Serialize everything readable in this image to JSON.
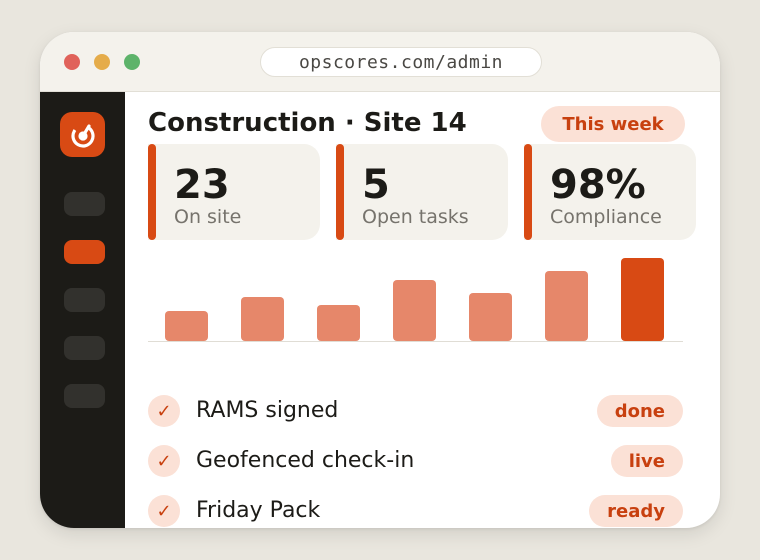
{
  "browser": {
    "url": "opscores.com/admin"
  },
  "sidebar": {
    "logo_icon": "crane-hook-icon",
    "accent": "#d84a14",
    "active_index": 1,
    "item_count": 5
  },
  "header": {
    "title": "Construction · Site 14",
    "period_pill": "This week"
  },
  "stats": [
    {
      "value": "23",
      "label": "On site"
    },
    {
      "value": "5",
      "label": "Open tasks"
    },
    {
      "value": "98%",
      "label": "Compliance"
    }
  ],
  "chart_data": {
    "type": "bar",
    "categories": [
      "",
      "",
      "",
      "",
      "",
      "",
      ""
    ],
    "values": [
      28,
      40,
      33,
      56,
      44,
      64,
      76
    ],
    "highlight_index": 6,
    "ylim": [
      0,
      80
    ],
    "colors": {
      "normal": "#e6876a",
      "highlight": "#d84a14"
    }
  },
  "checklist": [
    {
      "label": "RAMS signed",
      "status": "done"
    },
    {
      "label": "Geofenced check-in",
      "status": "live"
    },
    {
      "label": "Friday Pack",
      "status": "ready"
    }
  ]
}
